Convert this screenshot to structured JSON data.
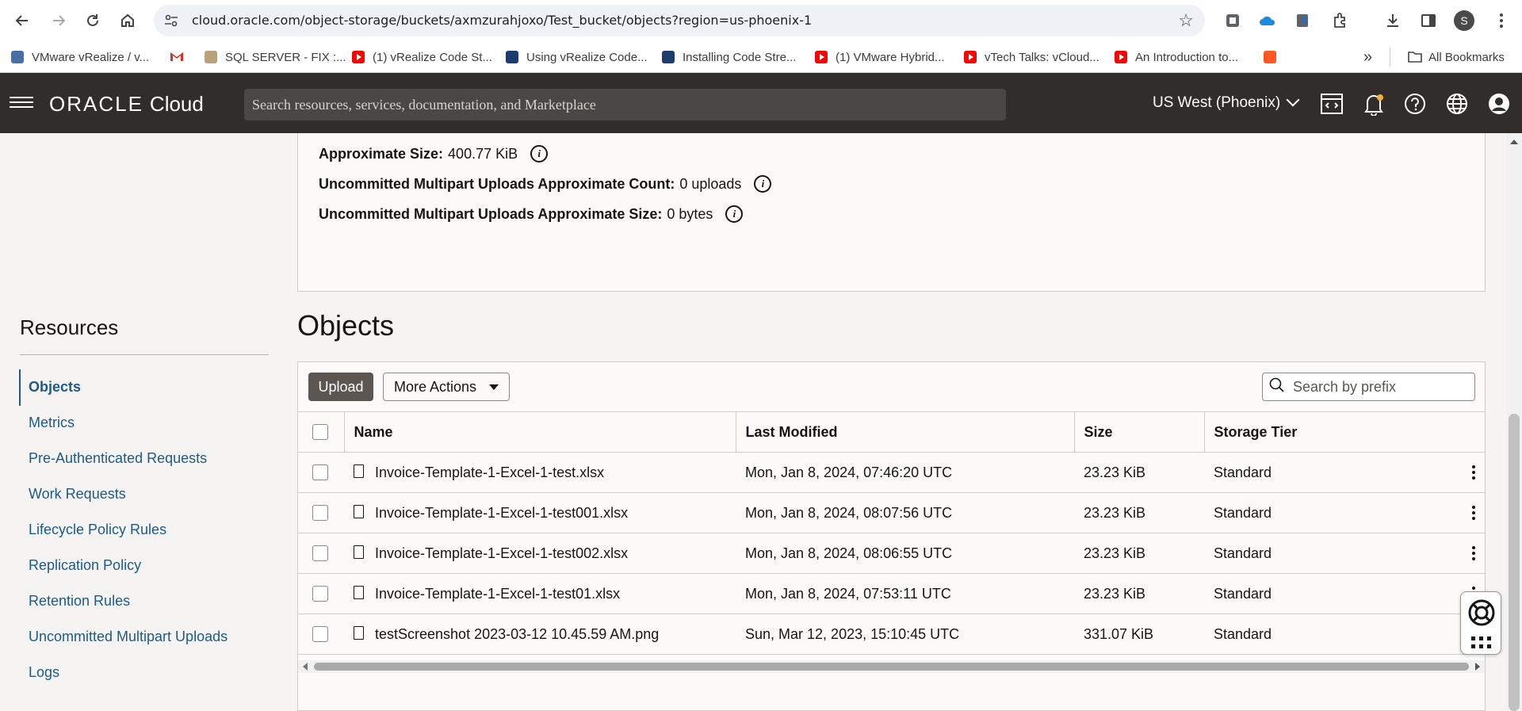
{
  "browser": {
    "url": "cloud.oracle.com/object-storage/buckets/axmzurahjoxo/Test_bucket/objects?region=us-phoenix-1",
    "profile_initial": "S",
    "bookmarks": [
      {
        "label": "VMware vRealize / v...",
        "icon": "vmware-icon"
      },
      {
        "label": "",
        "icon": "gmail-icon"
      },
      {
        "label": "SQL SERVER - FIX :...",
        "icon": "sqlserver-icon"
      },
      {
        "label": "(1) vRealize Code St...",
        "icon": "youtube-icon"
      },
      {
        "label": "Using vRealize Code...",
        "icon": "vmware-docs-icon"
      },
      {
        "label": "Installing Code Stre...",
        "icon": "vmware-docs-icon"
      },
      {
        "label": "(1) VMware Hybrid...",
        "icon": "youtube-icon"
      },
      {
        "label": "vTech Talks: vCloud...",
        "icon": "youtube-icon"
      },
      {
        "label": "An Introduction to...",
        "icon": "youtube-icon"
      },
      {
        "label": "",
        "icon": "orange-app-icon"
      }
    ],
    "more_bookmarks": "»",
    "all_bookmarks": "All Bookmarks"
  },
  "header": {
    "logo_oracle": "ORACLE",
    "logo_cloud": "Cloud",
    "search_placeholder": "Search resources, services, documentation, and Marketplace",
    "region": "US West (Phoenix)"
  },
  "details": {
    "approx_size_label": "Approximate Size:",
    "approx_size_value": "400.77 KiB",
    "multipart_count_label": "Uncommitted Multipart Uploads Approximate Count:",
    "multipart_count_value": "0 uploads",
    "multipart_size_label": "Uncommitted Multipart Uploads Approximate Size:",
    "multipart_size_value": "0 bytes"
  },
  "resources": {
    "title": "Resources",
    "items": [
      {
        "label": "Objects",
        "active": true
      },
      {
        "label": "Metrics"
      },
      {
        "label": "Pre-Authenticated Requests"
      },
      {
        "label": "Work Requests"
      },
      {
        "label": "Lifecycle Policy Rules"
      },
      {
        "label": "Replication Policy"
      },
      {
        "label": "Retention Rules"
      },
      {
        "label": "Uncommitted Multipart Uploads"
      },
      {
        "label": "Logs"
      }
    ]
  },
  "objects": {
    "title": "Objects",
    "upload_label": "Upload",
    "more_actions_label": "More Actions",
    "search_placeholder": "Search by prefix",
    "columns": [
      "Name",
      "Last Modified",
      "Size",
      "Storage Tier"
    ],
    "rows": [
      {
        "name": "Invoice-Template-1-Excel-1-test.xlsx",
        "modified": "Mon, Jan 8, 2024, 07:46:20 UTC",
        "size": "23.23 KiB",
        "tier": "Standard"
      },
      {
        "name": "Invoice-Template-1-Excel-1-test001.xlsx",
        "modified": "Mon, Jan 8, 2024, 08:07:56 UTC",
        "size": "23.23 KiB",
        "tier": "Standard"
      },
      {
        "name": "Invoice-Template-1-Excel-1-test002.xlsx",
        "modified": "Mon, Jan 8, 2024, 08:06:55 UTC",
        "size": "23.23 KiB",
        "tier": "Standard"
      },
      {
        "name": "Invoice-Template-1-Excel-1-test01.xlsx",
        "modified": "Mon, Jan 8, 2024, 07:53:11 UTC",
        "size": "23.23 KiB",
        "tier": "Standard"
      },
      {
        "name": "testScreenshot 2023-03-12 10.45.59 AM.png",
        "modified": "Sun, Mar 12, 2023, 15:10:45 UTC",
        "size": "331.07 KiB",
        "tier": "Standard"
      }
    ]
  },
  "colors": {
    "header_bg": "#312d2a",
    "link": "#1e5a86",
    "upload_button": "#5b5651"
  }
}
